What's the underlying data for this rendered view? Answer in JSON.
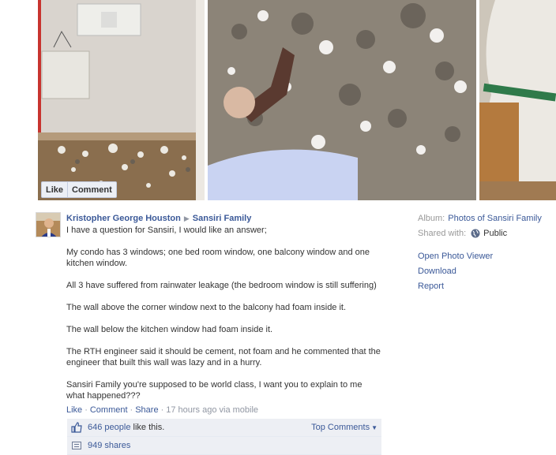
{
  "photo_actions": {
    "like": "Like",
    "comment": "Comment"
  },
  "post": {
    "author": "Kristopher George Houston",
    "target": "Sansiri Family",
    "paragraphs": [
      "I have a question for Sansiri, I would like an answer;",
      "My condo has 3 windows; one bed room window, one balcony window and one kitchen window.",
      "All 3 have suffered from rainwater leakage (the bedroom window is still suffering)",
      "The wall above the corner window next to the balcony had foam inside it.",
      "The wall below the kitchen window had foam inside it.",
      "The RTH engineer said it should be cement, not foam and he commented that the engineer that built this wall was lazy and in a hurry.",
      "Sansiri Family you're supposed to be world class, I want you to explain to me what happened???"
    ],
    "actions": {
      "like": "Like",
      "comment": "Comment",
      "share": "Share",
      "time": "17 hours ago via mobile"
    },
    "likes_count": "646 people",
    "likes_suffix": " like this.",
    "top_comments": "Top Comments",
    "shares": "949 shares"
  },
  "sidebar": {
    "album_label": "Album:",
    "album_value": "Photos of Sansiri Family",
    "shared_label": "Shared with:",
    "shared_value": "Public",
    "links": [
      "Open Photo Viewer",
      "Download",
      "Report"
    ]
  },
  "icons": {
    "thumb": "thumbs-up-icon",
    "share": "share-icon",
    "globe": "globe-icon",
    "arrow": "triangle-right-icon",
    "caret": "caret-down-icon"
  },
  "colors": {
    "link": "#3b5998",
    "muted": "#9197a3",
    "feedback_bg": "#edeff4"
  }
}
